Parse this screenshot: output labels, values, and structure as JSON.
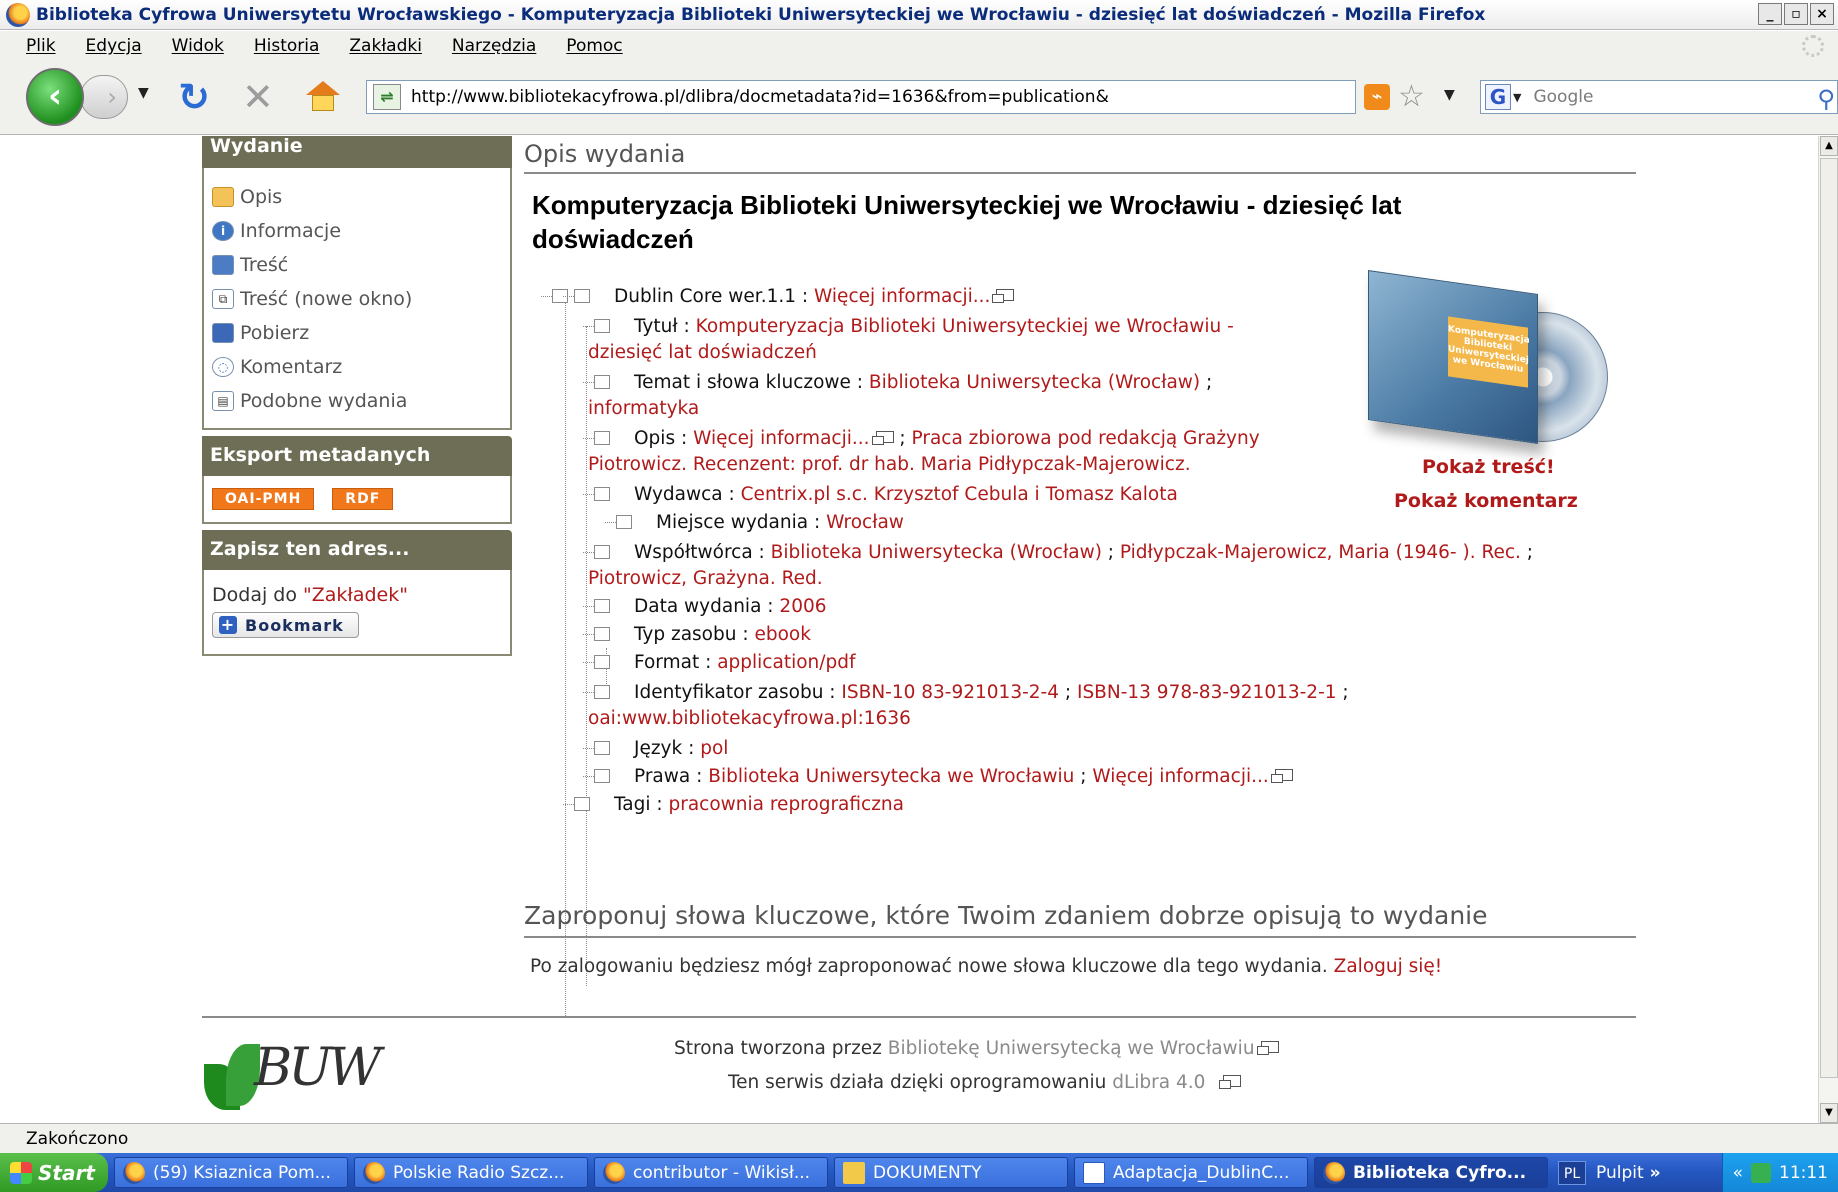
{
  "window": {
    "title": "Biblioteka Cyfrowa Uniwersytetu Wrocławskiego - Komputeryzacja Biblioteki Uniwersyteckiej we Wrocławiu - dziesięć lat doświadczeń - Mozilla Firefox",
    "min_label": "_",
    "max_label": "▫",
    "close_label": "×"
  },
  "menu": {
    "items": [
      "Plik",
      "Edycja",
      "Widok",
      "Historia",
      "Zakładki",
      "Narzędzia",
      "Pomoc"
    ]
  },
  "toolbar": {
    "url": "http://www.bibliotekacyfrowa.pl/dlibra/docmetadata?id=1636&from=publication&",
    "search_placeholder": "Google",
    "search_engine_glyph": "G"
  },
  "sidebar": {
    "wydanie_header": "Wydanie",
    "items": [
      {
        "label": "Opis",
        "icon": "document-icon"
      },
      {
        "label": "Informacje",
        "icon": "info-icon"
      },
      {
        "label": "Treść",
        "icon": "book-icon"
      },
      {
        "label": "Treść (nowe okno)",
        "icon": "new-window-icon"
      },
      {
        "label": "Pobierz",
        "icon": "save-icon"
      },
      {
        "label": "Komentarz",
        "icon": "comment-icon"
      },
      {
        "label": "Podobne wydania",
        "icon": "similar-icon"
      }
    ],
    "export_header": "Eksport metadanych",
    "export_badges": [
      "OAI-PMH",
      "RDF"
    ],
    "save_header": "Zapisz ten adres...",
    "save_text": "Dodaj do ",
    "save_quote": "\"Zakładek\"",
    "bookmark_label": "Bookmark"
  },
  "main": {
    "section_heading": "Opis wydania",
    "title": "Komputeryzacja Biblioteki Uniwersyteckiej we Wrocławiu - dziesięć lat doświadczeń",
    "tree": {
      "root_label": "Dublin Core wer.1.1",
      "root_link": "Więcej informacji...",
      "tytul_label": "Tytuł",
      "tytul_value_1": "Komputeryzacja Biblioteki Uniwersyteckiej we Wrocławiu -",
      "tytul_value_2": "dziesięć lat doświadczeń",
      "temat_label": "Temat i słowa kluczowe",
      "temat_value_1": "Biblioteka Uniwersytecka (Wrocław)",
      "temat_value_2": "informatyka",
      "opis_label": "Opis",
      "opis_link": "Więcej informacji...",
      "opis_value_1": "Praca zbiorowa pod redakcją Grażyny",
      "opis_value_2": "Piotrowicz. Recenzent: prof. dr hab. Maria Pidłypczak-Majerowicz.",
      "wydawca_label": "Wydawca",
      "wydawca_value": "Centrix.pl s.c. Krzysztof Cebula i Tomasz Kalota",
      "miejsce_label": "Miejsce wydania",
      "miejsce_value": "Wrocław",
      "wspol_label": "Współtwórca",
      "wspol_value_1": "Biblioteka Uniwersytecka (Wrocław)",
      "wspol_value_2": "Pidłypczak-Majerowicz, Maria (1946- ). Rec.",
      "wspol_value_3": "Piotrowicz, Grażyna. Red.",
      "data_label": "Data wydania",
      "data_value": "2006",
      "typ_label": "Typ zasobu",
      "typ_value": "ebook",
      "format_label": "Format",
      "format_value": "application/pdf",
      "ident_label": "Identyfikator zasobu",
      "ident_value_1": "ISBN-10 83-921013-2-4",
      "ident_value_2": "ISBN-13 978-83-921013-2-1",
      "ident_value_3": "oai:www.bibliotekacyfrowa.pl:1636",
      "jezyk_label": "Język",
      "jezyk_value": "pol",
      "prawa_label": "Prawa",
      "prawa_value_1": "Biblioteka Uniwersytecka we Wrocławiu",
      "prawa_link": "Więcej informacji...",
      "tagi_label": "Tagi",
      "tagi_value": "pracownia reprograficzna"
    },
    "cover_label": "Komputeryzacja Biblioteki Uniwersyteckiej we Wrocławiu",
    "show_content": "Pokaż treść!",
    "show_comment": "Pokaż komentarz",
    "suggest_heading": "Zaproponuj słowa kluczowe, które Twoim zdaniem dobrze opisują to wydanie",
    "login_text": "Po zalogowaniu będziesz mógł zaproponować nowe słowa kluczowe dla tego wydania. ",
    "login_link": "Zaloguj się!"
  },
  "footer": {
    "logo_text": "BUW",
    "line1_text": "Strona tworzona przez ",
    "line1_link": "Bibliotekę Uniwersytecką we Wrocławiu",
    "line2_text": "Ten serwis działa dzięki oprogramowaniu ",
    "line2_link": "dLibra 4.0"
  },
  "status": {
    "text": "Zakończono"
  },
  "taskbar": {
    "start_label": "Start",
    "tasks": [
      "(59) Ksiaznica Pom...",
      "Polskie Radio Szcz...",
      "contributor - Wikisł...",
      "DOKUMENTY",
      "Adaptacja_DublinC...",
      "Biblioteka Cyfro..."
    ],
    "lang": "PL",
    "pulpit": "Pulpit",
    "chevrons": "»",
    "tray_chevrons": "«",
    "clock": "11:11"
  },
  "colors": {
    "link": "#b11a1a",
    "sidebar_header": "#6e6e57",
    "badge": "#f0771a",
    "taskbar": "#2456c0"
  }
}
